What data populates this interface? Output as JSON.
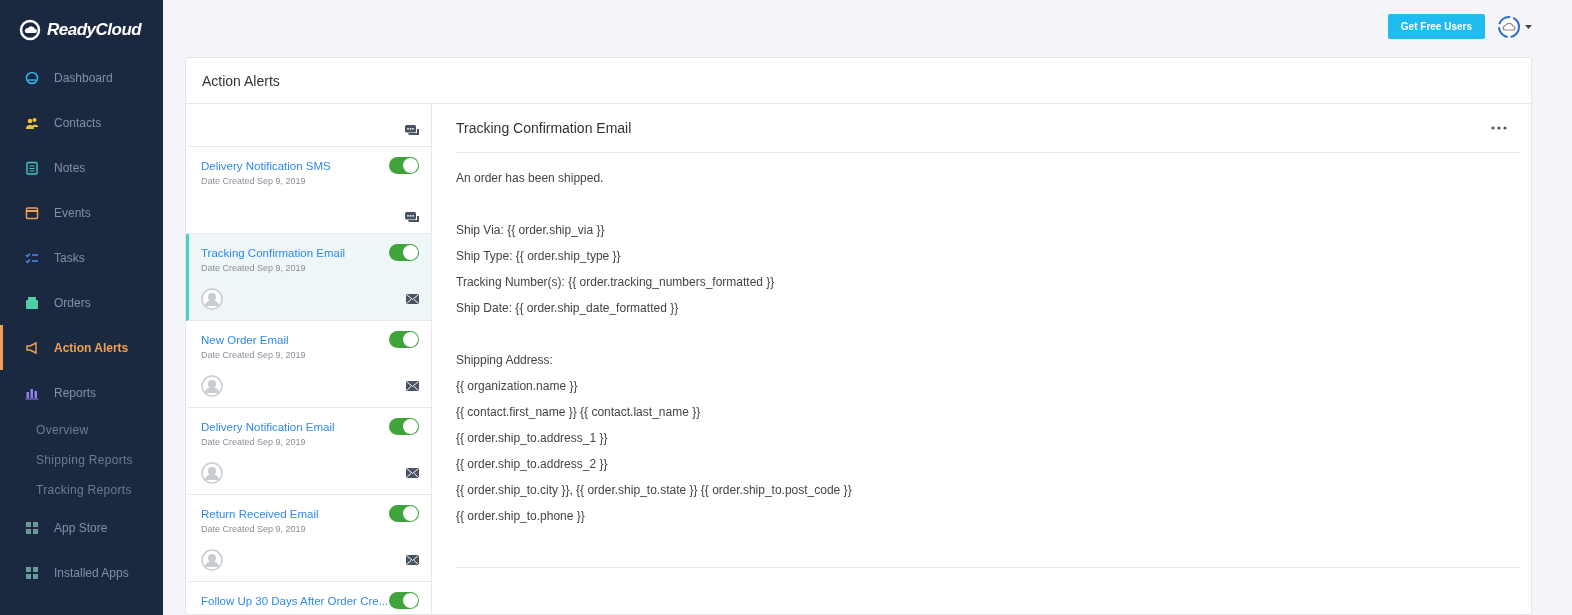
{
  "brand": "ReadyCloud",
  "sidebar": {
    "items": [
      {
        "label": "Dashboard",
        "kind": "dashboard",
        "selected": false
      },
      {
        "label": "Contacts",
        "kind": "contacts",
        "selected": false
      },
      {
        "label": "Notes",
        "kind": "notes",
        "selected": false
      },
      {
        "label": "Events",
        "kind": "events",
        "selected": false
      },
      {
        "label": "Tasks",
        "kind": "tasks",
        "selected": false
      },
      {
        "label": "Orders",
        "kind": "orders",
        "selected": false
      },
      {
        "label": "Action Alerts",
        "kind": "alerts",
        "selected": true
      },
      {
        "label": "Reports",
        "kind": "reports",
        "selected": false,
        "children": [
          {
            "label": "Overview",
            "selected": false
          },
          {
            "label": "Shipping Reports",
            "selected": false
          },
          {
            "label": "Tracking Reports",
            "selected": false
          }
        ]
      },
      {
        "label": "App Store",
        "kind": "apps",
        "selected": false
      },
      {
        "label": "Installed Apps",
        "kind": "apps",
        "selected": false
      }
    ]
  },
  "topbar": {
    "button": "Get Free Users"
  },
  "panel_title": "Action Alerts",
  "alerts": [
    {
      "kind": "sms",
      "selected": false
    },
    {
      "kind": "sms",
      "title": "Delivery Notification SMS",
      "date": "Date Created Sep 9, 2019",
      "on": true,
      "selected": false
    },
    {
      "kind": "email",
      "title": "Tracking Confirmation Email",
      "date": "Date Created Sep 9, 2019",
      "on": true,
      "selected": true
    },
    {
      "kind": "email",
      "title": "New Order Email",
      "date": "Date Created Sep 9, 2019",
      "on": true,
      "selected": false
    },
    {
      "kind": "email",
      "title": "Delivery Notification Email",
      "date": "Date Created Sep 9, 2019",
      "on": true,
      "selected": false
    },
    {
      "kind": "email",
      "title": "Return Received Email",
      "date": "Date Created Sep 9, 2019",
      "on": true,
      "selected": false
    },
    {
      "title": "Follow Up 30 Days After Order Cre...",
      "on": true,
      "selected": false
    }
  ],
  "detail": {
    "title": "Tracking Confirmation Email",
    "paragraphs": [
      [
        "An order has been shipped."
      ],
      [
        "Ship Via: {{ order.ship_via }}",
        "Ship Type: {{ order.ship_type }}",
        "Tracking Number(s): {{ order.tracking_numbers_formatted }}",
        "Ship Date: {{ order.ship_date_formatted }}"
      ],
      [
        "Shipping Address:",
        "{{ organization.name }}",
        "{{ contact.first_name }} {{ contact.last_name }}",
        "{{ order.ship_to.address_1 }}",
        "{{ order.ship_to.address_2 }}",
        "{{ order.ship_to.city }}, {{ order.ship_to.state }} {{ order.ship_to.post_code }}",
        "{{ order.ship_to.phone }}"
      ]
    ]
  }
}
